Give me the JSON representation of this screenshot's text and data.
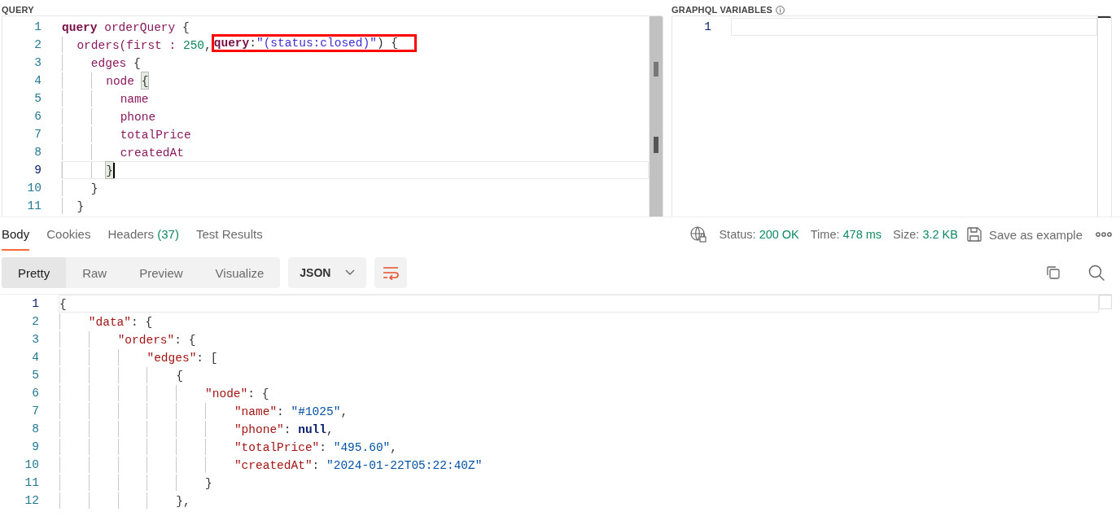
{
  "query_panel": {
    "title": "QUERY",
    "lines": [
      {
        "number": "1",
        "current": false,
        "tokens": [
          {
            "text": "query",
            "kind": "keyword"
          },
          {
            "text": " orderQuery ",
            "kind": "field"
          },
          {
            "text": "{",
            "kind": "punct"
          }
        ]
      },
      {
        "number": "2",
        "current": false,
        "tokens": [
          {
            "text": "  orders(first : ",
            "kind": "field"
          },
          {
            "text": "250",
            "kind": "number"
          },
          {
            "text": ",",
            "kind": "punct"
          },
          {
            "text": "query",
            "kind": "keyword",
            "annotated": true
          },
          {
            "text": ":",
            "kind": "punct",
            "annotated": true
          },
          {
            "text": "\"(status:closed)\"",
            "kind": "string",
            "annotated": true
          },
          {
            "text": ") {",
            "kind": "punct",
            "annotated": true
          }
        ]
      },
      {
        "number": "3",
        "current": false,
        "tokens": [
          {
            "text": "    edges ",
            "kind": "field"
          },
          {
            "text": "{",
            "kind": "punct"
          }
        ]
      },
      {
        "number": "4",
        "current": false,
        "tokens": [
          {
            "text": "      node ",
            "kind": "field"
          },
          {
            "text": "{",
            "kind": "punct",
            "matched": true
          }
        ]
      },
      {
        "number": "5",
        "current": false,
        "tokens": [
          {
            "text": "        name",
            "kind": "field"
          }
        ]
      },
      {
        "number": "6",
        "current": false,
        "tokens": [
          {
            "text": "        phone",
            "kind": "field"
          }
        ]
      },
      {
        "number": "7",
        "current": false,
        "tokens": [
          {
            "text": "        totalPrice",
            "kind": "field"
          }
        ]
      },
      {
        "number": "8",
        "current": false,
        "tokens": [
          {
            "text": "        createdAt",
            "kind": "field"
          }
        ]
      },
      {
        "number": "9",
        "current": true,
        "caret": true,
        "tokens": [
          {
            "text": "      }",
            "kind": "punct",
            "matched": true
          }
        ]
      },
      {
        "number": "10",
        "current": false,
        "tokens": [
          {
            "text": "    }",
            "kind": "punct"
          }
        ]
      },
      {
        "number": "11",
        "current": false,
        "tokens": [
          {
            "text": "  }",
            "kind": "punct"
          }
        ]
      }
    ]
  },
  "variables_panel": {
    "title": "GRAPHQL VARIABLES",
    "lines": [
      {
        "number": "1",
        "current": true
      }
    ]
  },
  "response_tabs": [
    {
      "label": "Body",
      "selected": true
    },
    {
      "label": "Cookies",
      "selected": false
    },
    {
      "label": "Headers",
      "count": "(37)",
      "selected": false
    },
    {
      "label": "Test Results",
      "selected": false
    }
  ],
  "response_meta": [
    {
      "label": "Status:",
      "value": "200 OK"
    },
    {
      "label": "Time:",
      "value": "478 ms"
    },
    {
      "label": "Size:",
      "value": "3.2 KB"
    }
  ],
  "save_example": "Save as example",
  "view_tabs": [
    {
      "label": "Pretty",
      "selected": true
    },
    {
      "label": "Raw",
      "selected": false
    },
    {
      "label": "Preview",
      "selected": false
    },
    {
      "label": "Visualize",
      "selected": false
    }
  ],
  "format": "JSON",
  "wrap_on": true,
  "response_lines": [
    {
      "number": "1",
      "current": true,
      "tokens": [
        {
          "text": "{",
          "kind": "punct"
        }
      ]
    },
    {
      "number": "2",
      "current": false,
      "tokens": [
        {
          "text": "    \"data\"",
          "kind": "key"
        },
        {
          "text": ": {",
          "kind": "punct"
        }
      ]
    },
    {
      "number": "3",
      "current": false,
      "tokens": [
        {
          "text": "        \"orders\"",
          "kind": "key"
        },
        {
          "text": ": {",
          "kind": "punct"
        }
      ]
    },
    {
      "number": "4",
      "current": false,
      "tokens": [
        {
          "text": "            \"edges\"",
          "kind": "key"
        },
        {
          "text": ": [",
          "kind": "punct"
        }
      ]
    },
    {
      "number": "5",
      "current": false,
      "tokens": [
        {
          "text": "                {",
          "kind": "punct"
        }
      ]
    },
    {
      "number": "6",
      "current": false,
      "tokens": [
        {
          "text": "                    \"node\"",
          "kind": "key"
        },
        {
          "text": ": {",
          "kind": "punct"
        }
      ]
    },
    {
      "number": "7",
      "current": false,
      "tokens": [
        {
          "text": "                        \"name\"",
          "kind": "key"
        },
        {
          "text": ": ",
          "kind": "punct"
        },
        {
          "text": "\"#1025\"",
          "kind": "value"
        },
        {
          "text": ",",
          "kind": "punct"
        }
      ]
    },
    {
      "number": "8",
      "current": false,
      "tokens": [
        {
          "text": "                        \"phone\"",
          "kind": "key"
        },
        {
          "text": ": ",
          "kind": "punct"
        },
        {
          "text": "null",
          "kind": "null"
        },
        {
          "text": ",",
          "kind": "punct"
        }
      ]
    },
    {
      "number": "9",
      "current": false,
      "tokens": [
        {
          "text": "                        \"totalPrice\"",
          "kind": "key"
        },
        {
          "text": ": ",
          "kind": "punct"
        },
        {
          "text": "\"495.60\"",
          "kind": "value"
        },
        {
          "text": ",",
          "kind": "punct"
        }
      ]
    },
    {
      "number": "10",
      "current": false,
      "tokens": [
        {
          "text": "                        \"createdAt\"",
          "kind": "key"
        },
        {
          "text": ": ",
          "kind": "punct"
        },
        {
          "text": "\"2024-01-22T05:22:40Z\"",
          "kind": "value"
        }
      ]
    },
    {
      "number": "11",
      "current": false,
      "tokens": [
        {
          "text": "                    }",
          "kind": "punct"
        }
      ]
    },
    {
      "number": "12",
      "current": false,
      "tokens": [
        {
          "text": "                },",
          "kind": "punct"
        }
      ]
    }
  ]
}
